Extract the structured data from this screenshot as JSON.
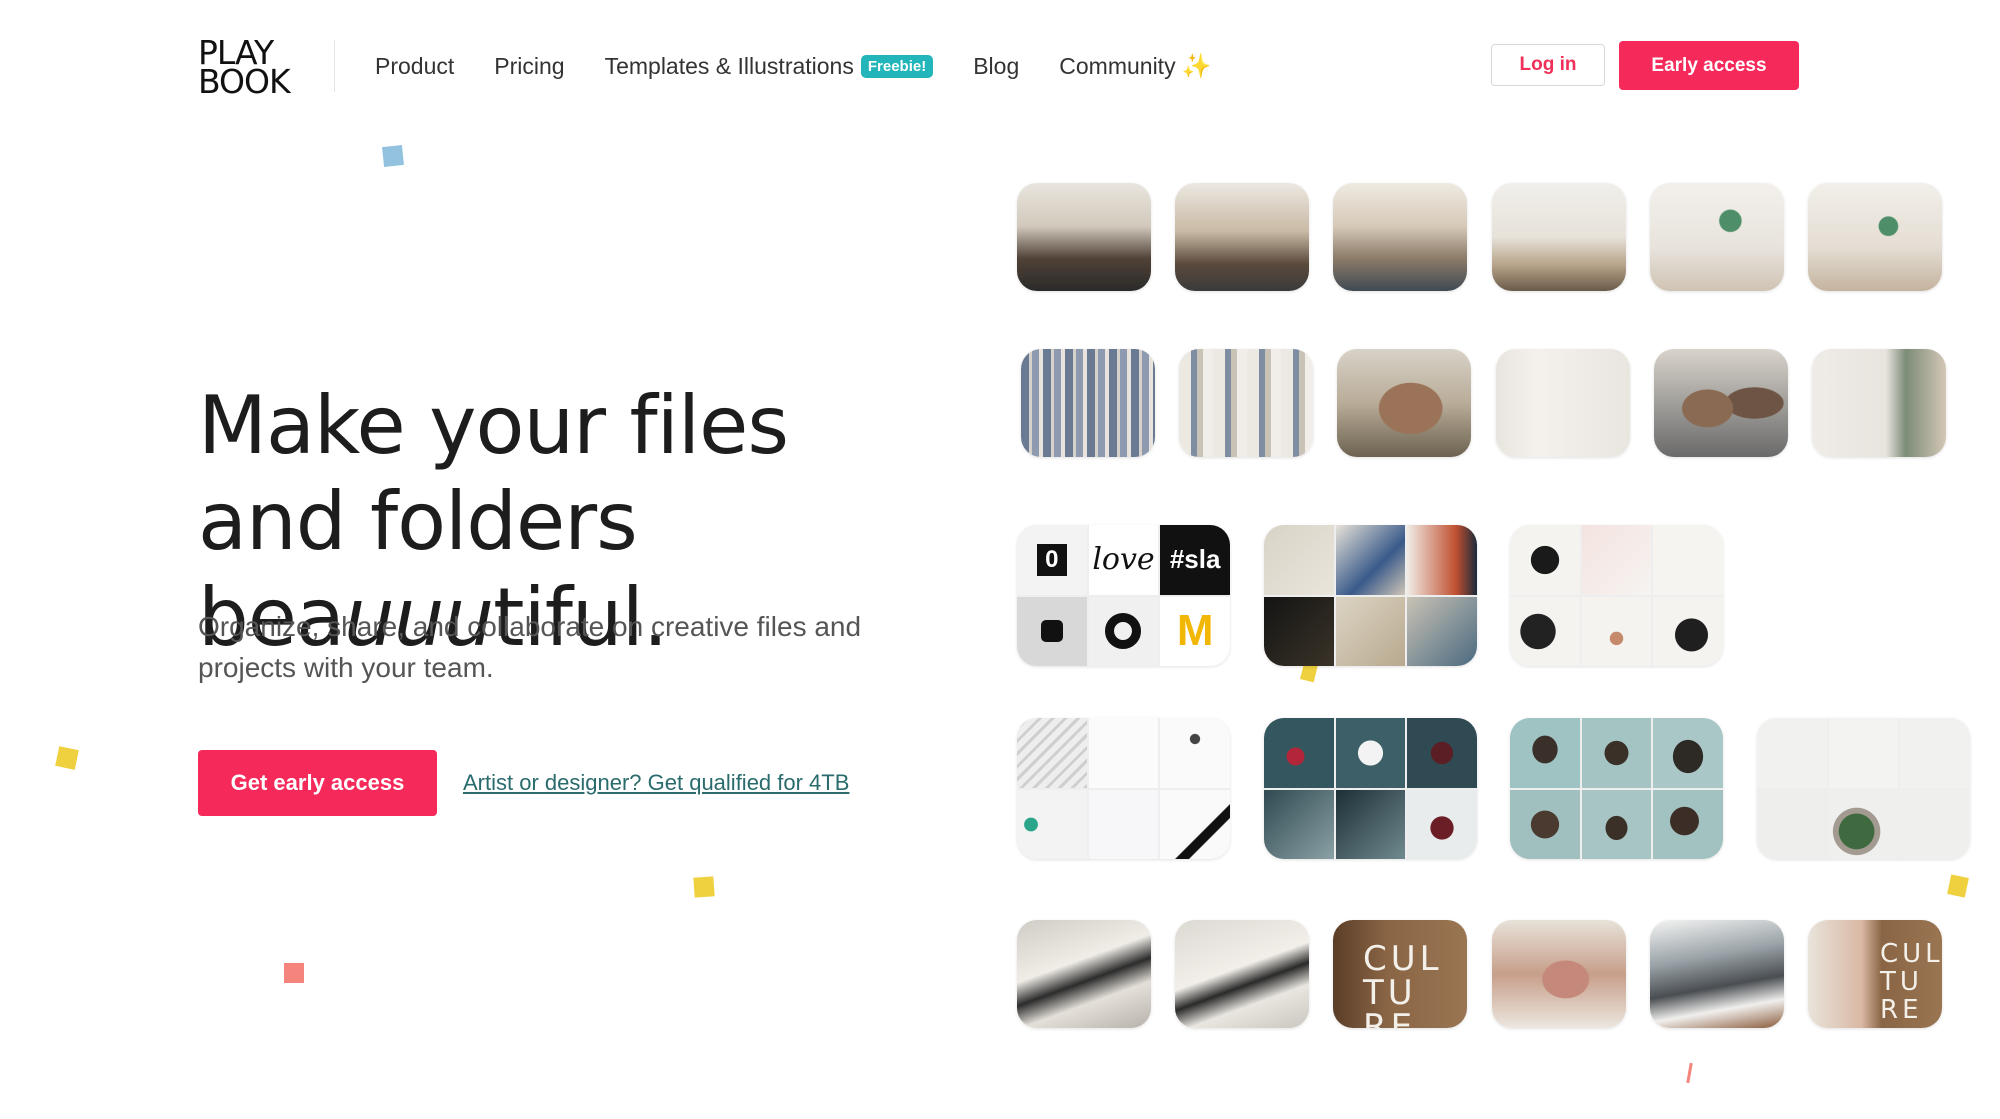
{
  "logo": {
    "line1": "PLAY",
    "line2": "BOOK"
  },
  "nav": {
    "product": "Product",
    "pricing": "Pricing",
    "templates": "Templates & Illustrations",
    "templates_badge": "Freebie!",
    "blog": "Blog",
    "community": "Community",
    "community_icon": "sparkle-icon"
  },
  "header": {
    "login_label": "Log in",
    "early_access_label": "Early access"
  },
  "hero": {
    "title_part1": "Make your files and folders bea",
    "title_italic": "uuu",
    "title_part2": "tiful.",
    "subtitle": "Organize, share, and collaborate on creative files and projects with your team.",
    "cta_label": "Get early access",
    "link_label": "Artist or designer? Get qualified for 4TB"
  },
  "tiles": {
    "logo_tile_zero": "0",
    "logo_tile_love": "love",
    "logo_tile_slack": "#sla",
    "logo_tile_m": "M",
    "culture_text": "CUL TU RE",
    "culture_text_2": "CUL TU RE"
  },
  "colors": {
    "accent": "#f5295a",
    "badge": "#22b5b9",
    "link": "#2a6b6d"
  }
}
